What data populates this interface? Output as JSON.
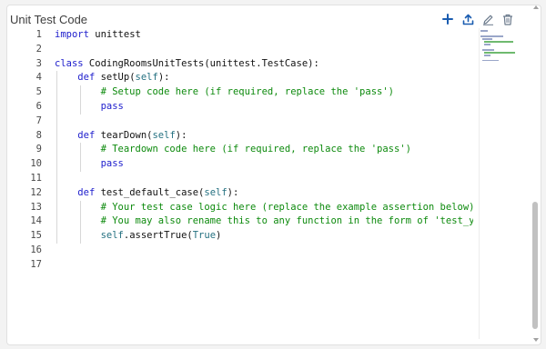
{
  "panel": {
    "title": "Unit Test Code"
  },
  "toolbar": {
    "icons": [
      "plus-icon",
      "upload-icon",
      "pencil-icon",
      "trash-icon"
    ],
    "accent_color": "#1a5cb0",
    "muted_color": "#6b7a8c"
  },
  "editor": {
    "lines": [
      {
        "num": "1",
        "indent": "",
        "tokens": [
          {
            "t": "kw",
            "s": "import"
          },
          {
            "t": "",
            "s": " unittest"
          }
        ]
      },
      {
        "num": "2",
        "indent": "",
        "tokens": []
      },
      {
        "num": "3",
        "indent": "",
        "tokens": [
          {
            "t": "kw",
            "s": "class"
          },
          {
            "t": "",
            "s": " CodingRoomsUnitTests(unittest.TestCase):"
          }
        ]
      },
      {
        "num": "4",
        "indent": "    ",
        "tokens": [
          {
            "t": "kw",
            "s": "def"
          },
          {
            "t": "",
            "s": " setUp("
          },
          {
            "t": "bi",
            "s": "self"
          },
          {
            "t": "",
            "s": "):"
          }
        ]
      },
      {
        "num": "5",
        "indent": "        ",
        "tokens": [
          {
            "t": "cm",
            "s": "# Setup code here (if required, replace the 'pass')"
          }
        ]
      },
      {
        "num": "6",
        "indent": "        ",
        "tokens": [
          {
            "t": "kw",
            "s": "pass"
          }
        ]
      },
      {
        "num": "7",
        "indent": "",
        "tokens": []
      },
      {
        "num": "8",
        "indent": "    ",
        "tokens": [
          {
            "t": "kw",
            "s": "def"
          },
          {
            "t": "",
            "s": " tearDown("
          },
          {
            "t": "bi",
            "s": "self"
          },
          {
            "t": "",
            "s": "):"
          }
        ]
      },
      {
        "num": "9",
        "indent": "        ",
        "tokens": [
          {
            "t": "cm",
            "s": "# Teardown code here (if required, replace the 'pass')"
          }
        ]
      },
      {
        "num": "10",
        "indent": "        ",
        "tokens": [
          {
            "t": "kw",
            "s": "pass"
          }
        ]
      },
      {
        "num": "11",
        "indent": "",
        "tokens": []
      },
      {
        "num": "12",
        "indent": "    ",
        "tokens": [
          {
            "t": "kw",
            "s": "def"
          },
          {
            "t": "",
            "s": " test_default_case("
          },
          {
            "t": "bi",
            "s": "self"
          },
          {
            "t": "",
            "s": "):"
          }
        ]
      },
      {
        "num": "13",
        "indent": "        ",
        "tokens": [
          {
            "t": "cm",
            "s": "# Your test case logic here (replace the example assertion below)"
          }
        ]
      },
      {
        "num": "14",
        "indent": "        ",
        "tokens": [
          {
            "t": "cm",
            "s": "# You may also rename this to any function in the form of 'test_your"
          }
        ]
      },
      {
        "num": "15",
        "indent": "        ",
        "tokens": [
          {
            "t": "bi",
            "s": "self"
          },
          {
            "t": "",
            "s": ".assertTrue("
          },
          {
            "t": "bi",
            "s": "True"
          },
          {
            "t": "",
            "s": ")"
          }
        ]
      },
      {
        "num": "16",
        "indent": "",
        "tokens": []
      },
      {
        "num": "17",
        "indent": "",
        "tokens": []
      }
    ]
  }
}
